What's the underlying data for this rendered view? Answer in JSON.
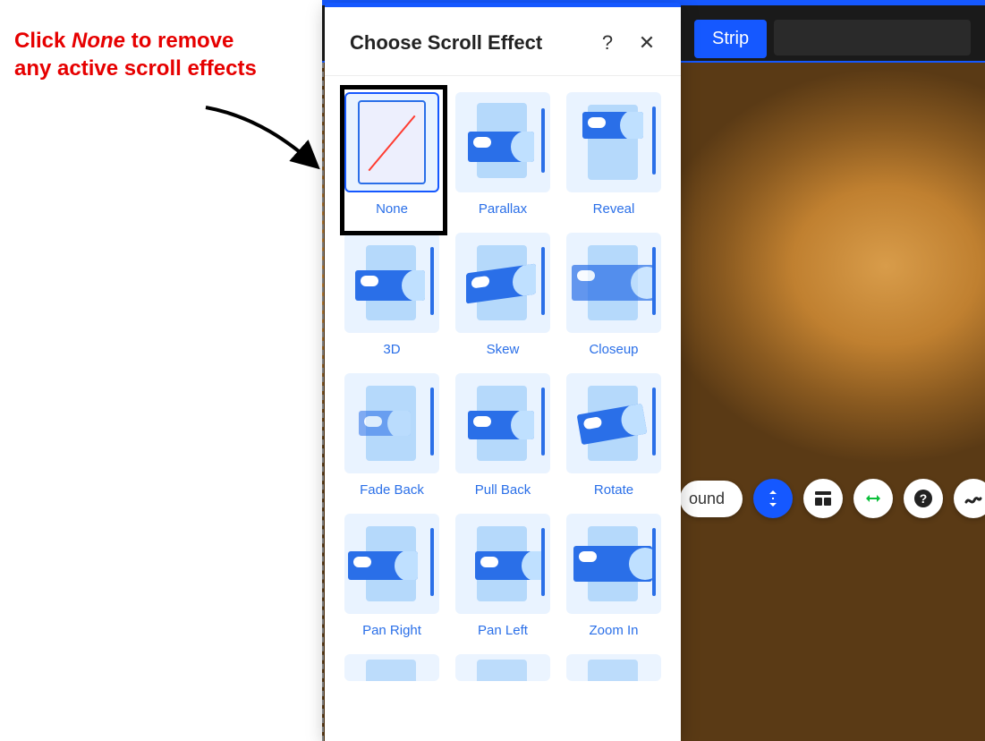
{
  "annotation": {
    "prefix": "Click ",
    "em": "None",
    "suffix": " to remove any active scroll effects"
  },
  "topbar": {
    "strip_label": "Strip"
  },
  "fab": {
    "pill_label": "ound"
  },
  "panel": {
    "title": "Choose Scroll Effect",
    "help": "?",
    "close": "✕"
  },
  "effects": [
    {
      "key": "none",
      "label": "None"
    },
    {
      "key": "parallax",
      "label": "Parallax"
    },
    {
      "key": "reveal",
      "label": "Reveal"
    },
    {
      "key": "threeD",
      "label": "3D"
    },
    {
      "key": "skew",
      "label": "Skew"
    },
    {
      "key": "closeup",
      "label": "Closeup"
    },
    {
      "key": "fadeback",
      "label": "Fade Back"
    },
    {
      "key": "pullback",
      "label": "Pull Back"
    },
    {
      "key": "rotate",
      "label": "Rotate"
    },
    {
      "key": "panright",
      "label": "Pan Right"
    },
    {
      "key": "panleft",
      "label": "Pan Left"
    },
    {
      "key": "zoomin",
      "label": "Zoom In"
    }
  ]
}
